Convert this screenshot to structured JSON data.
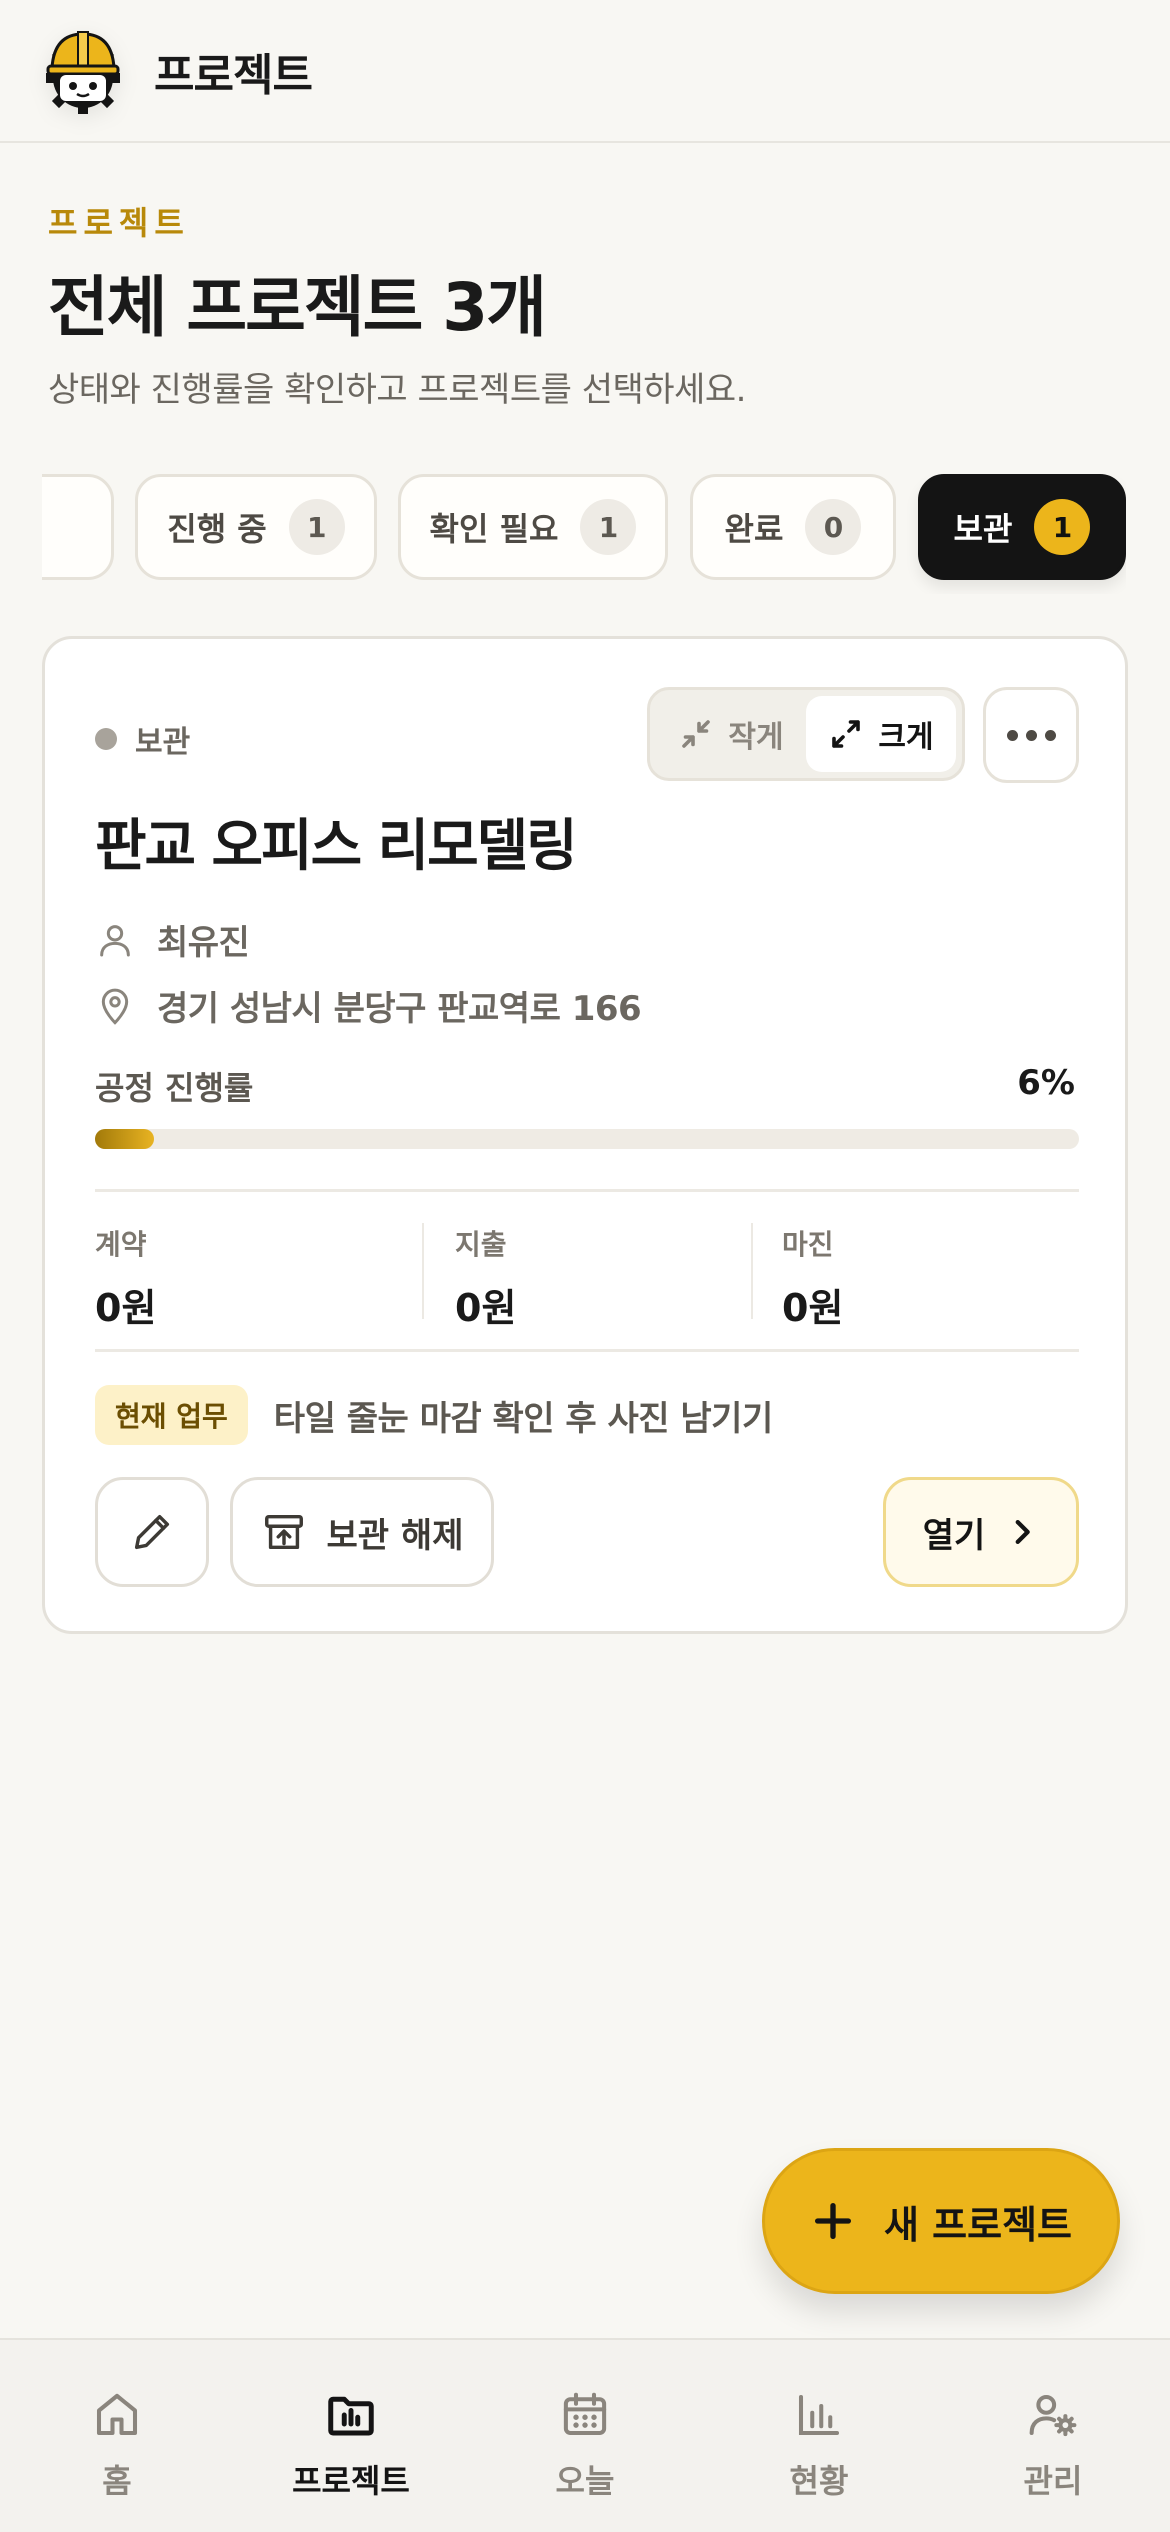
{
  "header": {
    "title": "프로젝트",
    "logo_icon": "hardhat-mascot-icon"
  },
  "intro": {
    "eyebrow": "프로젝트",
    "title": "전체 프로젝트 3개",
    "description": "상태와 진행률을 확인하고 프로젝트를 선택하세요."
  },
  "filters": [
    {
      "label": "",
      "count": "0",
      "active": false
    },
    {
      "label": "진행 중",
      "count": "1",
      "active": false
    },
    {
      "label": "확인 필요",
      "count": "1",
      "active": false
    },
    {
      "label": "완료",
      "count": "0",
      "active": false
    },
    {
      "label": "보관",
      "count": "1",
      "active": true
    }
  ],
  "card": {
    "status": "보관",
    "size_toggle": {
      "small": "작게",
      "large": "크게",
      "selected": "large"
    },
    "name": "판교 오피스 리모델링",
    "manager": "최유진",
    "address": "경기 성남시 분당구 판교역로 166",
    "progress_label": "공정 진행률",
    "progress_text": "6%",
    "progress_value": 0.06,
    "metrics": [
      {
        "label": "계약",
        "value": "0원"
      },
      {
        "label": "지출",
        "value": "0원"
      },
      {
        "label": "마진",
        "value": "0원"
      }
    ],
    "task_badge": "현재 업무",
    "task_text": "타일 줄눈 마감 확인 후 사진 남기기",
    "unarchive_label": "보관 해제",
    "open_label": "열기"
  },
  "fab": {
    "label": "새 프로젝트"
  },
  "nav": [
    {
      "label": "홈",
      "icon": "home-icon",
      "active": false
    },
    {
      "label": "프로젝트",
      "icon": "folder-chart-icon",
      "active": true
    },
    {
      "label": "오늘",
      "icon": "calendar-icon",
      "active": false
    },
    {
      "label": "현황",
      "icon": "bar-chart-icon",
      "active": false
    },
    {
      "label": "관리",
      "icon": "user-settings-icon",
      "active": false
    }
  ],
  "colors": {
    "accent": "#ecb51b",
    "eyebrow": "#b8890a",
    "active_chip": "#141414",
    "background": "#f8f7f3"
  }
}
